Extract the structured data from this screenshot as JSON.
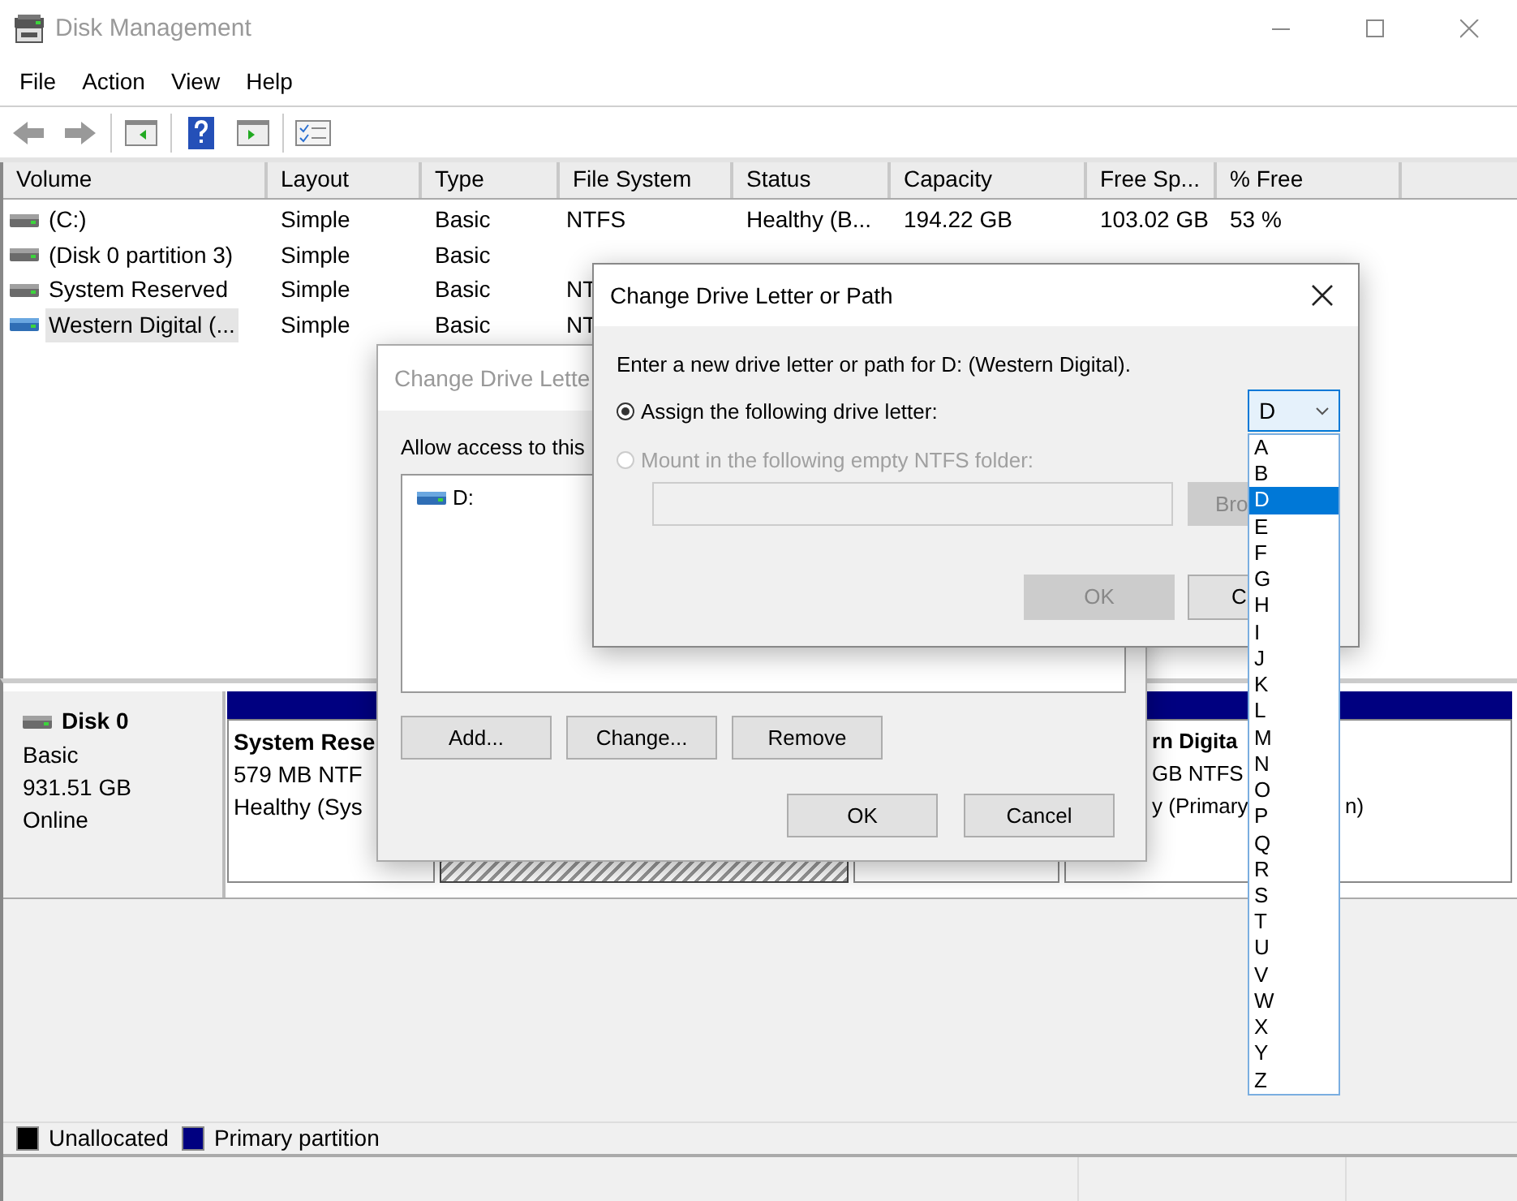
{
  "window": {
    "title": "Disk Management"
  },
  "menu": [
    "File",
    "Action",
    "View",
    "Help"
  ],
  "volumes": {
    "columns": [
      "Volume",
      "Layout",
      "Type",
      "File System",
      "Status",
      "Capacity",
      "Free Sp...",
      "% Free"
    ],
    "rows": [
      {
        "kind": "system",
        "selected": false,
        "cells": [
          "(C:)",
          "Simple",
          "Basic",
          "NTFS",
          "Healthy (B...",
          "194.22 GB",
          "103.02 GB",
          "53 %"
        ]
      },
      {
        "kind": "system",
        "selected": false,
        "cells": [
          "(Disk 0 partition 3)",
          "Simple",
          "Basic"
        ]
      },
      {
        "kind": "system",
        "selected": false,
        "cells": [
          "System Reserved",
          "Simple",
          "Basic",
          "NT"
        ]
      },
      {
        "kind": "external",
        "selected": true,
        "cells": [
          "Western Digital (...",
          "Simple",
          "Basic",
          "NT"
        ]
      }
    ]
  },
  "disk": {
    "name": "Disk 0",
    "type": "Basic",
    "size": "931.51 GB",
    "status": "Online",
    "partitions": [
      {
        "selected": false,
        "lines": [
          "System Rese",
          "579 MB NTF",
          "Healthy (Sys"
        ]
      },
      {
        "selected": true
      },
      {
        "selected": false
      },
      {
        "selected": false,
        "lines": [
          "rn Digita",
          "GB NTFS",
          "y (Primary",
          "n)"
        ]
      }
    ]
  },
  "legend": [
    {
      "label": "Unallocated",
      "color": "#000000"
    },
    {
      "label": "Primary partition",
      "color": "#000080"
    }
  ],
  "back_dialog": {
    "title": "Change Drive Lette",
    "prompt": "Allow access to this",
    "items": [
      {
        "label": "D:",
        "selected": false
      }
    ],
    "buttons": [
      "Add...",
      "Change...",
      "Remove"
    ],
    "footer_buttons": [
      "OK",
      "Cancel"
    ]
  },
  "front_dialog": {
    "title": "Change Drive Letter or Path",
    "prompt": "Enter a new drive letter or path for D: (Western Digital).",
    "options": [
      {
        "label": "Assign the following drive letter:",
        "selected": true,
        "disabled": false
      },
      {
        "label": "Mount in the following empty NTFS folder:",
        "selected": false,
        "disabled": true
      }
    ],
    "drive_letter": "D",
    "browse_button": {
      "label": "Bro",
      "disabled": true
    },
    "buttons": [
      {
        "label": "OK",
        "disabled": true
      },
      {
        "label": "C",
        "disabled": false
      }
    ],
    "letters": [
      {
        "label": "A",
        "selected": false
      },
      {
        "label": "B",
        "selected": false
      },
      {
        "label": "D",
        "selected": true
      },
      {
        "label": "E",
        "selected": false
      },
      {
        "label": "F",
        "selected": false
      },
      {
        "label": "G",
        "selected": false
      },
      {
        "label": "H",
        "selected": false
      },
      {
        "label": "I",
        "selected": false
      },
      {
        "label": "J",
        "selected": false
      },
      {
        "label": "K",
        "selected": false
      },
      {
        "label": "L",
        "selected": false
      },
      {
        "label": "M",
        "selected": false
      },
      {
        "label": "N",
        "selected": false
      },
      {
        "label": "O",
        "selected": false
      },
      {
        "label": "P",
        "selected": false
      },
      {
        "label": "Q",
        "selected": false
      },
      {
        "label": "R",
        "selected": false
      },
      {
        "label": "S",
        "selected": false
      },
      {
        "label": "T",
        "selected": false
      },
      {
        "label": "U",
        "selected": false
      },
      {
        "label": "V",
        "selected": false
      },
      {
        "label": "W",
        "selected": false
      },
      {
        "label": "X",
        "selected": false
      },
      {
        "label": "Y",
        "selected": false
      },
      {
        "label": "Z",
        "selected": false
      }
    ]
  }
}
